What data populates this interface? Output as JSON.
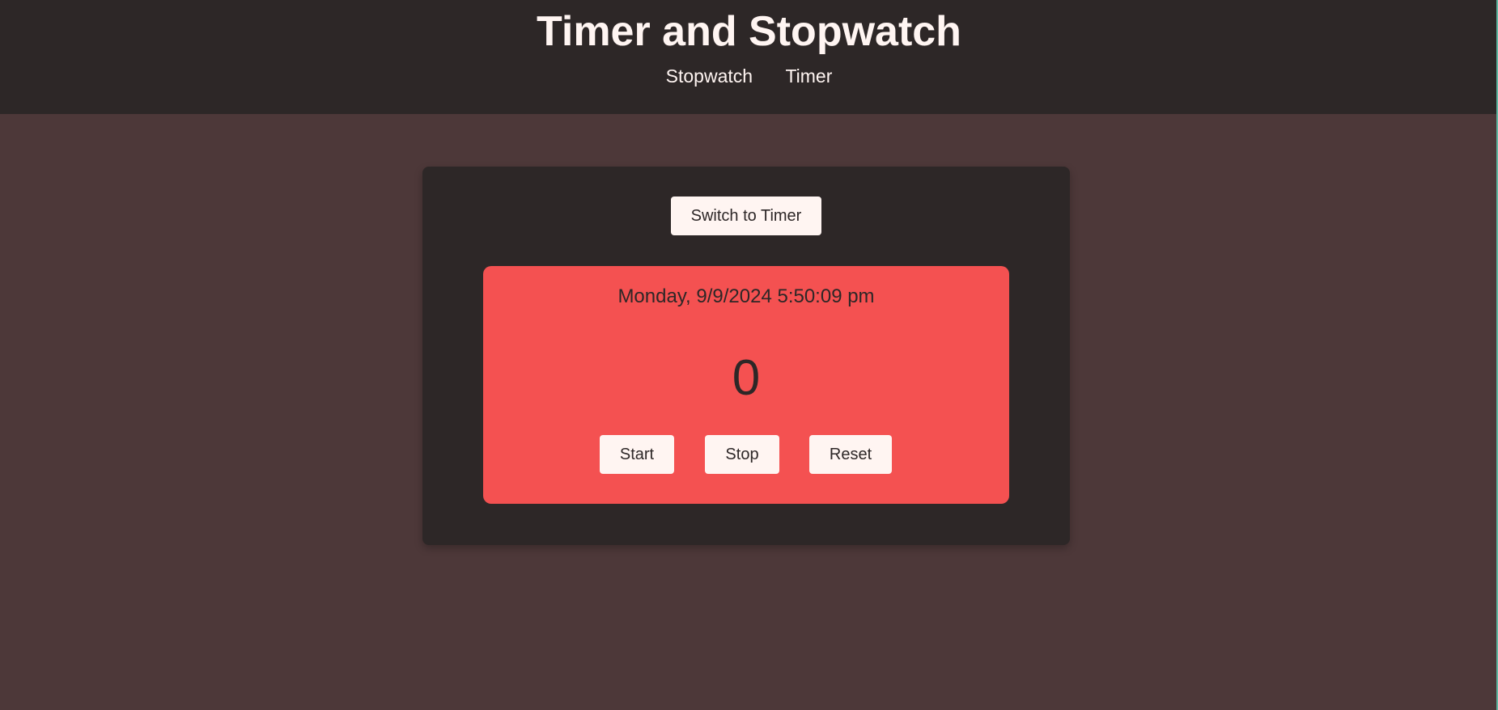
{
  "header": {
    "title": "Timer and Stopwatch",
    "nav": [
      {
        "label": "Stopwatch"
      },
      {
        "label": "Timer"
      }
    ]
  },
  "card": {
    "switch_label": "Switch to Timer",
    "panel": {
      "datetime": "Monday, 9/9/2024 5:50:09 pm",
      "counter": "0",
      "buttons": {
        "start": "Start",
        "stop": "Stop",
        "reset": "Reset"
      }
    }
  },
  "colors": {
    "page_bg": "#4d3839",
    "header_bg": "#2d2727",
    "card_bg": "#2d2727",
    "panel_bg": "#f45151",
    "button_bg": "#fff5f2",
    "text_light": "#fff5f2",
    "text_dark": "#2d2727"
  }
}
